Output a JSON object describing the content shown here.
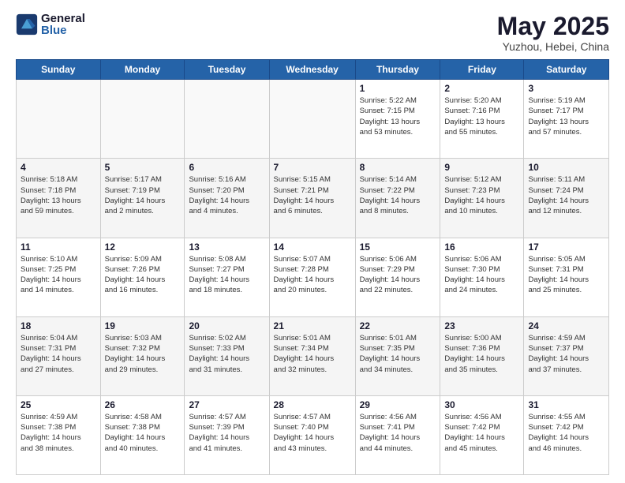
{
  "logo": {
    "general": "General",
    "blue": "Blue"
  },
  "header": {
    "month_year": "May 2025",
    "location": "Yuzhou, Hebei, China"
  },
  "weekdays": [
    "Sunday",
    "Monday",
    "Tuesday",
    "Wednesday",
    "Thursday",
    "Friday",
    "Saturday"
  ],
  "weeks": [
    [
      {
        "day": "",
        "info": ""
      },
      {
        "day": "",
        "info": ""
      },
      {
        "day": "",
        "info": ""
      },
      {
        "day": "",
        "info": ""
      },
      {
        "day": "1",
        "info": "Sunrise: 5:22 AM\nSunset: 7:15 PM\nDaylight: 13 hours\nand 53 minutes."
      },
      {
        "day": "2",
        "info": "Sunrise: 5:20 AM\nSunset: 7:16 PM\nDaylight: 13 hours\nand 55 minutes."
      },
      {
        "day": "3",
        "info": "Sunrise: 5:19 AM\nSunset: 7:17 PM\nDaylight: 13 hours\nand 57 minutes."
      }
    ],
    [
      {
        "day": "4",
        "info": "Sunrise: 5:18 AM\nSunset: 7:18 PM\nDaylight: 13 hours\nand 59 minutes."
      },
      {
        "day": "5",
        "info": "Sunrise: 5:17 AM\nSunset: 7:19 PM\nDaylight: 14 hours\nand 2 minutes."
      },
      {
        "day": "6",
        "info": "Sunrise: 5:16 AM\nSunset: 7:20 PM\nDaylight: 14 hours\nand 4 minutes."
      },
      {
        "day": "7",
        "info": "Sunrise: 5:15 AM\nSunset: 7:21 PM\nDaylight: 14 hours\nand 6 minutes."
      },
      {
        "day": "8",
        "info": "Sunrise: 5:14 AM\nSunset: 7:22 PM\nDaylight: 14 hours\nand 8 minutes."
      },
      {
        "day": "9",
        "info": "Sunrise: 5:12 AM\nSunset: 7:23 PM\nDaylight: 14 hours\nand 10 minutes."
      },
      {
        "day": "10",
        "info": "Sunrise: 5:11 AM\nSunset: 7:24 PM\nDaylight: 14 hours\nand 12 minutes."
      }
    ],
    [
      {
        "day": "11",
        "info": "Sunrise: 5:10 AM\nSunset: 7:25 PM\nDaylight: 14 hours\nand 14 minutes."
      },
      {
        "day": "12",
        "info": "Sunrise: 5:09 AM\nSunset: 7:26 PM\nDaylight: 14 hours\nand 16 minutes."
      },
      {
        "day": "13",
        "info": "Sunrise: 5:08 AM\nSunset: 7:27 PM\nDaylight: 14 hours\nand 18 minutes."
      },
      {
        "day": "14",
        "info": "Sunrise: 5:07 AM\nSunset: 7:28 PM\nDaylight: 14 hours\nand 20 minutes."
      },
      {
        "day": "15",
        "info": "Sunrise: 5:06 AM\nSunset: 7:29 PM\nDaylight: 14 hours\nand 22 minutes."
      },
      {
        "day": "16",
        "info": "Sunrise: 5:06 AM\nSunset: 7:30 PM\nDaylight: 14 hours\nand 24 minutes."
      },
      {
        "day": "17",
        "info": "Sunrise: 5:05 AM\nSunset: 7:31 PM\nDaylight: 14 hours\nand 25 minutes."
      }
    ],
    [
      {
        "day": "18",
        "info": "Sunrise: 5:04 AM\nSunset: 7:31 PM\nDaylight: 14 hours\nand 27 minutes."
      },
      {
        "day": "19",
        "info": "Sunrise: 5:03 AM\nSunset: 7:32 PM\nDaylight: 14 hours\nand 29 minutes."
      },
      {
        "day": "20",
        "info": "Sunrise: 5:02 AM\nSunset: 7:33 PM\nDaylight: 14 hours\nand 31 minutes."
      },
      {
        "day": "21",
        "info": "Sunrise: 5:01 AM\nSunset: 7:34 PM\nDaylight: 14 hours\nand 32 minutes."
      },
      {
        "day": "22",
        "info": "Sunrise: 5:01 AM\nSunset: 7:35 PM\nDaylight: 14 hours\nand 34 minutes."
      },
      {
        "day": "23",
        "info": "Sunrise: 5:00 AM\nSunset: 7:36 PM\nDaylight: 14 hours\nand 35 minutes."
      },
      {
        "day": "24",
        "info": "Sunrise: 4:59 AM\nSunset: 7:37 PM\nDaylight: 14 hours\nand 37 minutes."
      }
    ],
    [
      {
        "day": "25",
        "info": "Sunrise: 4:59 AM\nSunset: 7:38 PM\nDaylight: 14 hours\nand 38 minutes."
      },
      {
        "day": "26",
        "info": "Sunrise: 4:58 AM\nSunset: 7:38 PM\nDaylight: 14 hours\nand 40 minutes."
      },
      {
        "day": "27",
        "info": "Sunrise: 4:57 AM\nSunset: 7:39 PM\nDaylight: 14 hours\nand 41 minutes."
      },
      {
        "day": "28",
        "info": "Sunrise: 4:57 AM\nSunset: 7:40 PM\nDaylight: 14 hours\nand 43 minutes."
      },
      {
        "day": "29",
        "info": "Sunrise: 4:56 AM\nSunset: 7:41 PM\nDaylight: 14 hours\nand 44 minutes."
      },
      {
        "day": "30",
        "info": "Sunrise: 4:56 AM\nSunset: 7:42 PM\nDaylight: 14 hours\nand 45 minutes."
      },
      {
        "day": "31",
        "info": "Sunrise: 4:55 AM\nSunset: 7:42 PM\nDaylight: 14 hours\nand 46 minutes."
      }
    ]
  ]
}
